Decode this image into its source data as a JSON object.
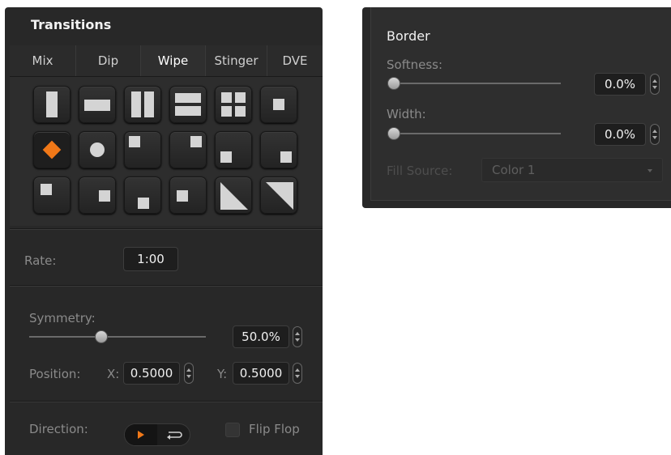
{
  "transitions": {
    "title": "Transitions",
    "tabs": [
      "Mix",
      "Dip",
      "Wipe",
      "Stinger",
      "DVE"
    ],
    "active_tab": "Wipe",
    "selected_pattern": "diamond",
    "patterns": [
      "vertical-bar",
      "horizontal-bar",
      "double-vertical-bars",
      "double-horizontal-bars",
      "four-box-grid",
      "center-box",
      "diamond",
      "circle",
      "box-top-left",
      "box-top-right",
      "box-bottom-right",
      "box-bottom-right-2",
      "box-left-top",
      "box-center-right",
      "box-center-bottom",
      "box-center-left",
      "diagonal-bottom-left",
      "diagonal-top-right"
    ],
    "rate": {
      "label": "Rate:",
      "value": "1:00"
    },
    "symmetry": {
      "label": "Symmetry:",
      "value": "50.0%",
      "fraction": 0.5
    },
    "position": {
      "label": "Position:",
      "x_label": "X:",
      "x_value": "0.5000",
      "y_label": "Y:",
      "y_value": "0.5000"
    },
    "direction": {
      "label": "Direction:",
      "normal_icon": "play-triangle-icon",
      "reverse_icon": "reverse-arrow-icon"
    },
    "flip_flop": {
      "label": "Flip Flop",
      "checked": false
    }
  },
  "border": {
    "title": "Border",
    "softness": {
      "label": "Softness:",
      "value": "0.0%",
      "fraction": 0.0
    },
    "width": {
      "label": "Width:",
      "value": "0.0%",
      "fraction": 0.0
    },
    "fill_source": {
      "label": "Fill Source:",
      "value": "Color 1"
    }
  },
  "colors": {
    "accent": "#f07818",
    "panel": "#282828",
    "text": "#d0d0d0"
  }
}
